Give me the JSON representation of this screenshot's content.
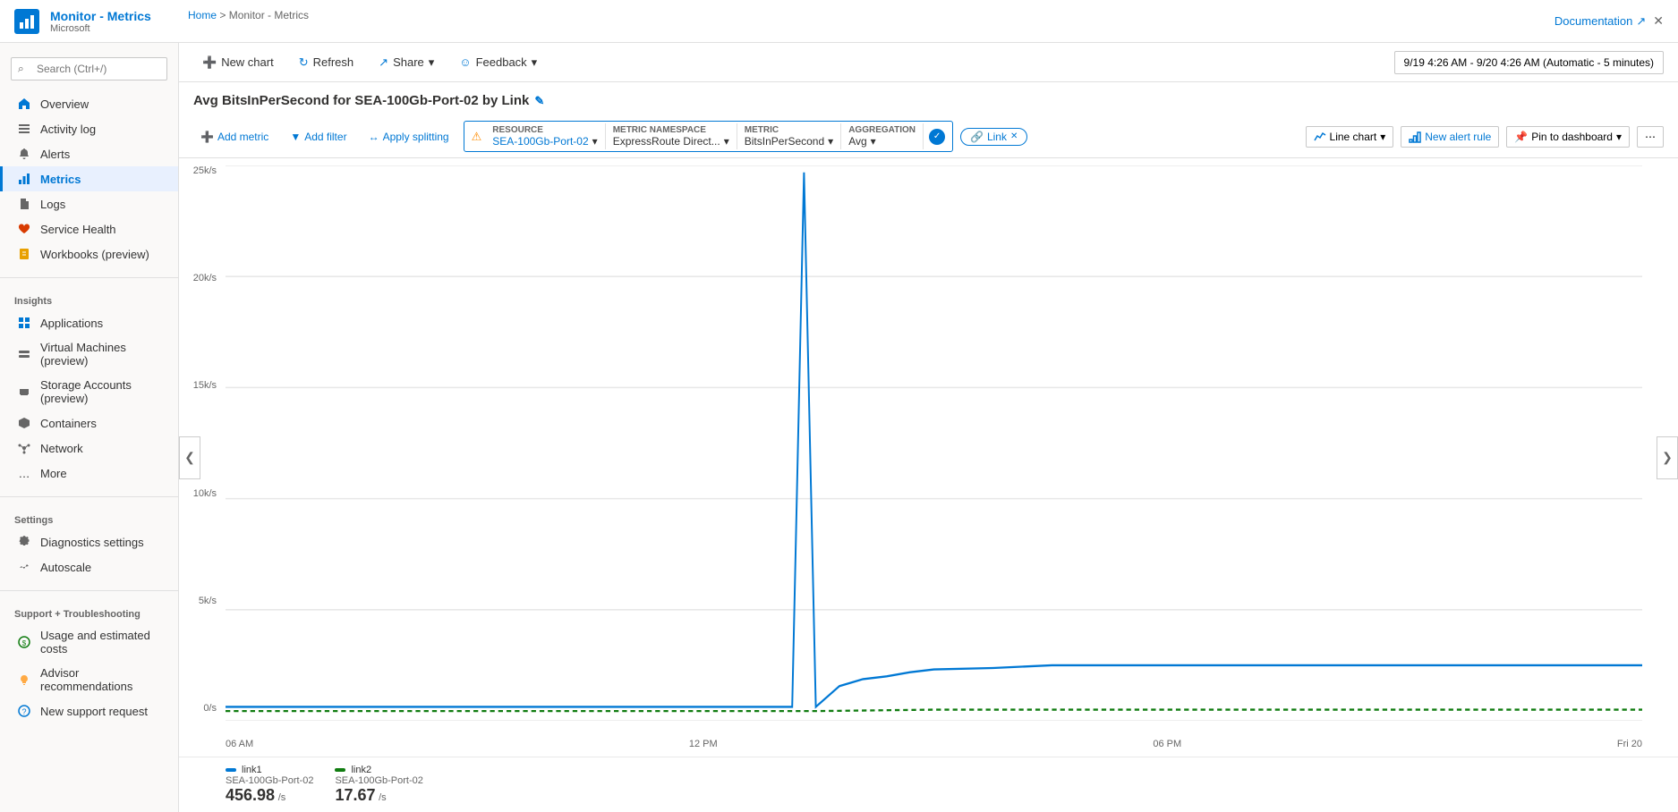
{
  "app": {
    "title": "Monitor - Metrics",
    "subtitle": "Microsoft",
    "doc_link": "Documentation"
  },
  "breadcrumb": {
    "home": "Home",
    "current": "Monitor - Metrics"
  },
  "search": {
    "placeholder": "Search (Ctrl+/)"
  },
  "sidebar": {
    "items": [
      {
        "id": "overview",
        "label": "Overview",
        "icon": "home"
      },
      {
        "id": "activity-log",
        "label": "Activity log",
        "icon": "list"
      },
      {
        "id": "alerts",
        "label": "Alerts",
        "icon": "bell"
      },
      {
        "id": "metrics",
        "label": "Metrics",
        "icon": "chart-bar",
        "active": true
      },
      {
        "id": "logs",
        "label": "Logs",
        "icon": "file-text"
      },
      {
        "id": "service-health",
        "label": "Service Health",
        "icon": "heartbeat"
      },
      {
        "id": "workbooks",
        "label": "Workbooks (preview)",
        "icon": "book"
      }
    ],
    "insights_label": "Insights",
    "insights_items": [
      {
        "id": "applications",
        "label": "Applications",
        "icon": "app"
      },
      {
        "id": "virtual-machines",
        "label": "Virtual Machines (preview)",
        "icon": "server"
      },
      {
        "id": "storage-accounts",
        "label": "Storage Accounts (preview)",
        "icon": "storage"
      },
      {
        "id": "containers",
        "label": "Containers",
        "icon": "box"
      },
      {
        "id": "network",
        "label": "Network",
        "icon": "network"
      },
      {
        "id": "more",
        "label": "More",
        "icon": "ellipsis"
      }
    ],
    "settings_label": "Settings",
    "settings_items": [
      {
        "id": "diagnostics",
        "label": "Diagnostics settings",
        "icon": "gear"
      },
      {
        "id": "autoscale",
        "label": "Autoscale",
        "icon": "scale"
      }
    ],
    "support_label": "Support + Troubleshooting",
    "support_items": [
      {
        "id": "usage-costs",
        "label": "Usage and estimated costs",
        "icon": "coins"
      },
      {
        "id": "advisor",
        "label": "Advisor recommendations",
        "icon": "lightbulb"
      },
      {
        "id": "support-request",
        "label": "New support request",
        "icon": "support"
      }
    ]
  },
  "toolbar": {
    "new_chart": "New chart",
    "refresh": "Refresh",
    "share": "Share",
    "feedback": "Feedback",
    "time_range": "9/19 4:26 AM - 9/20 4:26 AM (Automatic - 5 minutes)"
  },
  "chart": {
    "title": "Avg BitsInPerSecond for SEA-100Gb-Port-02 by Link",
    "add_metric": "Add metric",
    "add_filter": "Add filter",
    "apply_splitting": "Apply splitting",
    "resource_label": "RESOURCE",
    "resource_value": "SEA-100Gb-Port-02",
    "namespace_label": "METRIC NAMESPACE",
    "namespace_value": "ExpressRoute Direct...",
    "metric_label": "METRIC",
    "metric_value": "BitsInPerSecond",
    "aggregation_label": "AGGREGATION",
    "aggregation_value": "Avg",
    "link_tag": "Link",
    "line_chart": "Line chart",
    "new_alert_rule": "New alert rule",
    "pin_to_dashboard": "Pin to dashboard",
    "more_options": "...",
    "y_axis": [
      "25k/s",
      "20k/s",
      "15k/s",
      "10k/s",
      "5k/s",
      "0/s"
    ],
    "x_axis": [
      "06 AM",
      "12 PM",
      "06 PM",
      "Fri 20"
    ],
    "legend": [
      {
        "id": "link1",
        "color": "#0078d4",
        "label_line1": "link1",
        "label_line2": "SEA-100Gb-Port-02",
        "value": "456.98",
        "unit": "/s"
      },
      {
        "id": "link2",
        "color": "#107c10",
        "label_line1": "link2",
        "label_line2": "SEA-100Gb-Port-02",
        "value": "17.67",
        "unit": "/s"
      }
    ]
  }
}
